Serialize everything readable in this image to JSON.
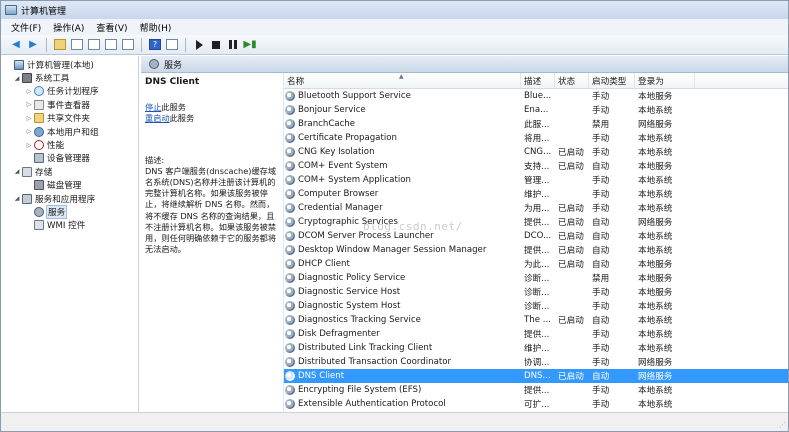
{
  "window": {
    "title": "计算机管理",
    "icon": "computer-management-icon"
  },
  "menu": [
    "文件(F)",
    "操作(A)",
    "查看(V)",
    "帮助(H)"
  ],
  "tree": {
    "items": [
      {
        "label": "计算机管理(本地)",
        "level": 0,
        "icon": "computer-icon",
        "expander": ""
      },
      {
        "label": "系统工具",
        "level": 1,
        "icon": "tools-icon",
        "expander": "◢"
      },
      {
        "label": "任务计划程序",
        "level": 2,
        "icon": "clock-icon",
        "expander": "▷"
      },
      {
        "label": "事件查看器",
        "level": 2,
        "icon": "event-viewer-icon",
        "expander": "▷"
      },
      {
        "label": "共享文件夹",
        "level": 2,
        "icon": "folder-icon",
        "expander": "▷"
      },
      {
        "label": "本地用户和组",
        "level": 2,
        "icon": "users-icon",
        "expander": "▷"
      },
      {
        "label": "性能",
        "level": 2,
        "icon": "performance-icon",
        "expander": "▷"
      },
      {
        "label": "设备管理器",
        "level": 2,
        "icon": "device-manager-icon",
        "expander": ""
      },
      {
        "label": "存储",
        "level": 1,
        "icon": "storage-icon",
        "expander": "◢"
      },
      {
        "label": "磁盘管理",
        "level": 2,
        "icon": "disk-icon",
        "expander": ""
      },
      {
        "label": "服务和应用程序",
        "level": 1,
        "icon": "services-apps-icon",
        "expander": "◢"
      },
      {
        "label": "服务",
        "level": 2,
        "icon": "gear-icon",
        "expander": "",
        "selected": true
      },
      {
        "label": "WMI 控件",
        "level": 2,
        "icon": "wmi-icon",
        "expander": ""
      }
    ]
  },
  "pane": {
    "header": "服务"
  },
  "description": {
    "title": "DNS Client",
    "stop_link": "停止",
    "stop_suffix": "此服务",
    "restart_link": "重启动",
    "restart_suffix": "此服务",
    "label": "描述:",
    "text": "DNS 客户端服务(dnscache)缓存域名系统(DNS)名称并注册该计算机的完整计算机名称。如果该服务被停止，将继续解析 DNS 名称。然而，将不缓存 DNS 名称的查询结果，且不注册计算机名称。如果该服务被禁用，则任何明确依赖于它的服务都将无法启动。"
  },
  "list": {
    "columns": [
      "名称",
      "描述",
      "状态",
      "启动类型",
      "登录为"
    ],
    "rows": [
      {
        "name": "Bluetooth Support Service",
        "desc": "Blue...",
        "state": "",
        "start": "手动",
        "logon": "本地服务"
      },
      {
        "name": "Bonjour Service",
        "desc": "Ena...",
        "state": "",
        "start": "手动",
        "logon": "本地系统"
      },
      {
        "name": "BranchCache",
        "desc": "此服...",
        "state": "",
        "start": "禁用",
        "logon": "网络服务"
      },
      {
        "name": "Certificate Propagation",
        "desc": "将用...",
        "state": "",
        "start": "手动",
        "logon": "本地系统"
      },
      {
        "name": "CNG Key Isolation",
        "desc": "CNG...",
        "state": "已启动",
        "start": "手动",
        "logon": "本地系统"
      },
      {
        "name": "COM+ Event System",
        "desc": "支持...",
        "state": "已启动",
        "start": "自动",
        "logon": "本地服务"
      },
      {
        "name": "COM+ System Application",
        "desc": "管理...",
        "state": "",
        "start": "手动",
        "logon": "本地系统"
      },
      {
        "name": "Computer Browser",
        "desc": "维护...",
        "state": "",
        "start": "手动",
        "logon": "本地系统"
      },
      {
        "name": "Credential Manager",
        "desc": "为用...",
        "state": "已启动",
        "start": "手动",
        "logon": "本地系统"
      },
      {
        "name": "Cryptographic Services",
        "desc": "提供...",
        "state": "已启动",
        "start": "自动",
        "logon": "网络服务"
      },
      {
        "name": "DCOM Server Process Launcher",
        "desc": "DCO...",
        "state": "已启动",
        "start": "自动",
        "logon": "本地系统"
      },
      {
        "name": "Desktop Window Manager Session Manager",
        "desc": "提供...",
        "state": "已启动",
        "start": "自动",
        "logon": "本地系统"
      },
      {
        "name": "DHCP Client",
        "desc": "为此...",
        "state": "已启动",
        "start": "自动",
        "logon": "本地服务"
      },
      {
        "name": "Diagnostic Policy Service",
        "desc": "诊断...",
        "state": "",
        "start": "禁用",
        "logon": "本地服务"
      },
      {
        "name": "Diagnostic Service Host",
        "desc": "诊断...",
        "state": "",
        "start": "手动",
        "logon": "本地服务"
      },
      {
        "name": "Diagnostic System Host",
        "desc": "诊断...",
        "state": "",
        "start": "手动",
        "logon": "本地系统"
      },
      {
        "name": "Diagnostics Tracking Service",
        "desc": "The ...",
        "state": "已启动",
        "start": "自动",
        "logon": "本地系统"
      },
      {
        "name": "Disk Defragmenter",
        "desc": "提供...",
        "state": "",
        "start": "手动",
        "logon": "本地系统"
      },
      {
        "name": "Distributed Link Tracking Client",
        "desc": "维护...",
        "state": "",
        "start": "手动",
        "logon": "本地系统"
      },
      {
        "name": "Distributed Transaction Coordinator",
        "desc": "协调...",
        "state": "",
        "start": "手动",
        "logon": "网络服务"
      },
      {
        "name": "DNS Client",
        "desc": "DNS...",
        "state": "已启动",
        "start": "自动",
        "logon": "网络服务",
        "selected": true
      },
      {
        "name": "Encrypting File System (EFS)",
        "desc": "提供...",
        "state": "",
        "start": "手动",
        "logon": "本地系统"
      },
      {
        "name": "Extensible Authentication Protocol",
        "desc": "可扩...",
        "state": "",
        "start": "手动",
        "logon": "本地系统"
      }
    ]
  },
  "watermark": "blog.csdn.net/",
  "colors": {
    "selection": "#3399ff",
    "link": "#1a56b8"
  }
}
